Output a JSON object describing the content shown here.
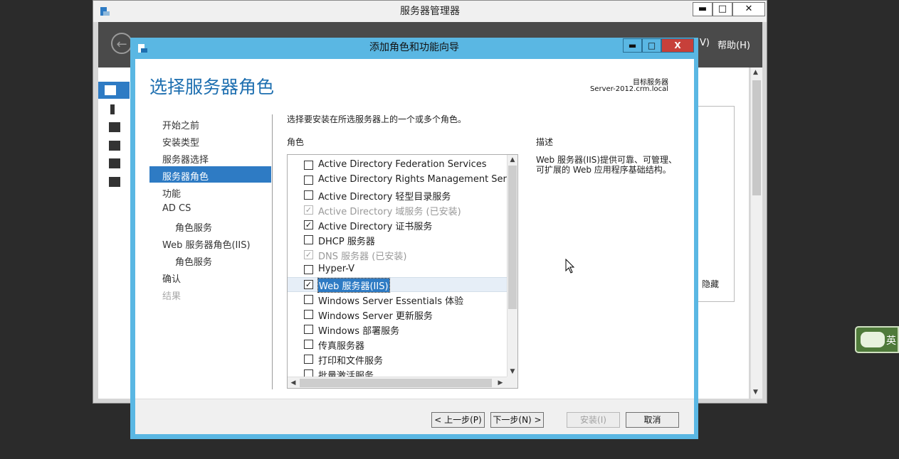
{
  "server_manager": {
    "title": "服务器管理器",
    "controls": {
      "minimize": "▬",
      "maximize": "□",
      "close": "✕"
    },
    "menu": {
      "view_partial": "V)",
      "help": "帮助(H)"
    },
    "hide_label": "隐藏"
  },
  "wizard": {
    "title": "添加角色和功能向导",
    "controls": {
      "minimize": "▬",
      "maximize": "□",
      "close": "X"
    },
    "heading": "选择服务器角色",
    "destination_label": "目标服务器",
    "destination_server": "Server-2012.crm.local",
    "nav": [
      {
        "label": "开始之前"
      },
      {
        "label": "安装类型"
      },
      {
        "label": "服务器选择"
      },
      {
        "label": "服务器角色"
      },
      {
        "label": "功能"
      },
      {
        "label": "AD CS"
      },
      {
        "label": "角色服务"
      },
      {
        "label": "Web 服务器角色(IIS)"
      },
      {
        "label": "角色服务"
      },
      {
        "label": "确认"
      },
      {
        "label": "结果"
      }
    ],
    "instruction": "选择要安装在所选服务器上的一个或多个角色。",
    "roles_header": "角色",
    "roles": [
      {
        "label": "Active Directory Federation Services",
        "checked": false
      },
      {
        "label": "Active Directory Rights Management Services",
        "checked": false
      },
      {
        "label": "Active Directory 轻型目录服务",
        "checked": false
      },
      {
        "label": "Active Directory 域服务 (已安装)",
        "checked": true,
        "disabled": true
      },
      {
        "label": "Active Directory 证书服务",
        "checked": true
      },
      {
        "label": "DHCP 服务器",
        "checked": false
      },
      {
        "label": "DNS 服务器 (已安装)",
        "checked": true,
        "disabled": true
      },
      {
        "label": "Hyper-V",
        "checked": false
      },
      {
        "label": "Web 服务器(IIS)",
        "checked": true,
        "selected": true
      },
      {
        "label": "Windows Server Essentials 体验",
        "checked": false
      },
      {
        "label": "Windows Server 更新服务",
        "checked": false
      },
      {
        "label": "Windows 部署服务",
        "checked": false
      },
      {
        "label": "传真服务器",
        "checked": false
      },
      {
        "label": "打印和文件服务",
        "checked": false
      },
      {
        "label": "批量激活服务",
        "checked": false
      }
    ],
    "description_header": "描述",
    "description": "Web 服务器(IIS)提供可靠、可管理、可扩展的 Web 应用程序基础结构。",
    "buttons": {
      "previous": "< 上一步(P)",
      "next": "下一步(N) >",
      "install": "安装(I)",
      "cancel": "取消"
    }
  },
  "ime": {
    "label": "英"
  },
  "colors": {
    "accent": "#2e7bc4",
    "dialog_frame": "#5ab7e3",
    "close_button": "#c7403a",
    "heading": "#1e6fb0"
  }
}
